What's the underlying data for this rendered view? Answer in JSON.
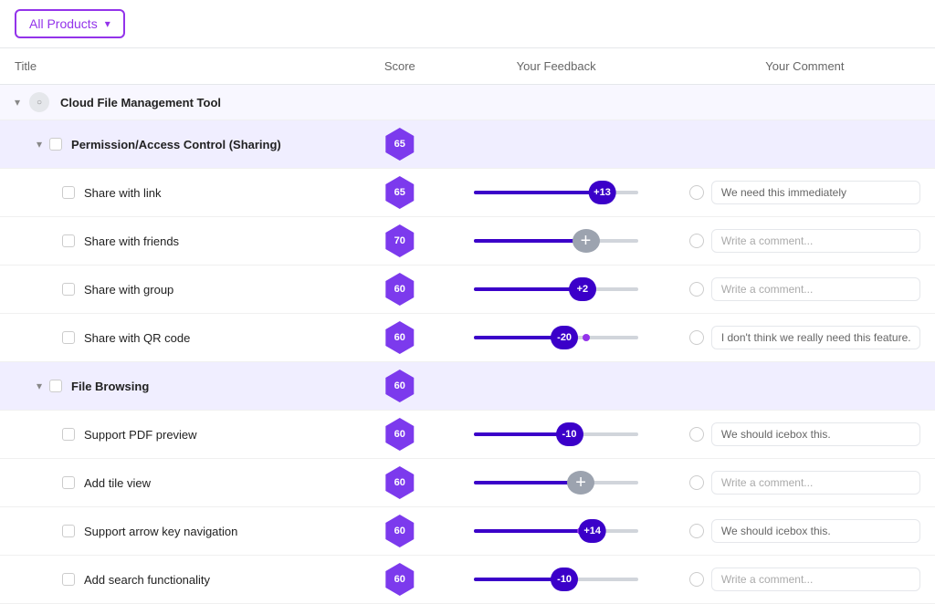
{
  "header": {
    "dropdown_label": "All Products",
    "dropdown_chevron": "▾"
  },
  "table": {
    "columns": [
      "Title",
      "Score",
      "Your Feedback",
      "Your Comment"
    ],
    "groups": [
      {
        "id": "cloud-file",
        "label": "Cloud File Management Tool",
        "indent": 0,
        "is_group": true,
        "has_avatar": true,
        "subgroups": [
          {
            "id": "permission",
            "label": "Permission/Access Control (Sharing)",
            "indent": 1,
            "is_subgroup": true,
            "score": "65",
            "rows": [
              {
                "id": "share-link",
                "label": "Share with link",
                "score": "65",
                "feedback": {
                  "filled_pct": 72,
                  "dot_pct": 72,
                  "bubble_pct": 78,
                  "bubble_val": "+13",
                  "bubble_type": "positive"
                },
                "comment_value": "We need this immediately"
              },
              {
                "id": "share-friends",
                "label": "Share with friends",
                "score": "70",
                "feedback": {
                  "filled_pct": 65,
                  "dot_pct": null,
                  "bubble_pct": 68,
                  "bubble_val": "+",
                  "bubble_type": "neutral"
                },
                "comment_value": "",
                "comment_placeholder": "Write a comment..."
              },
              {
                "id": "share-group",
                "label": "Share with group",
                "score": "60",
                "feedback": {
                  "filled_pct": 62,
                  "dot_pct": 62,
                  "bubble_pct": 66,
                  "bubble_val": "+2",
                  "bubble_type": "positive"
                },
                "comment_value": "",
                "comment_placeholder": "Write a comment..."
              },
              {
                "id": "share-qr",
                "label": "Share with QR code",
                "score": "60",
                "feedback": {
                  "filled_pct": 58,
                  "dot_pct": 68,
                  "bubble_pct": 55,
                  "bubble_val": "-20",
                  "bubble_type": "negative"
                },
                "comment_value": "I don't think we really need this feature."
              }
            ]
          },
          {
            "id": "file-browsing",
            "label": "File Browsing",
            "indent": 1,
            "is_subgroup": true,
            "score": "60",
            "rows": [
              {
                "id": "pdf-preview",
                "label": "Support PDF preview",
                "score": "60",
                "feedback": {
                  "filled_pct": 60,
                  "dot_pct": null,
                  "bubble_pct": 58,
                  "bubble_val": "-10",
                  "bubble_type": "negative"
                },
                "comment_value": "We should icebox this."
              },
              {
                "id": "tile-view",
                "label": "Add tile view",
                "score": "60",
                "feedback": {
                  "filled_pct": 62,
                  "dot_pct": null,
                  "bubble_pct": 65,
                  "bubble_val": "+",
                  "bubble_type": "neutral"
                },
                "comment_value": "",
                "comment_placeholder": "Write a comment..."
              },
              {
                "id": "arrow-nav",
                "label": "Support arrow key navigation",
                "score": "60",
                "feedback": {
                  "filled_pct": 65,
                  "dot_pct": 65,
                  "bubble_pct": 72,
                  "bubble_val": "+14",
                  "bubble_type": "positive"
                },
                "comment_value": "We should icebox this."
              },
              {
                "id": "search-func",
                "label": "Add search functionality",
                "score": "60",
                "feedback": {
                  "filled_pct": 60,
                  "dot_pct": null,
                  "bubble_pct": 55,
                  "bubble_val": "-10",
                  "bubble_type": "negative"
                },
                "comment_value": "",
                "comment_placeholder": "Write a comment..."
              }
            ]
          }
        ]
      }
    ]
  }
}
